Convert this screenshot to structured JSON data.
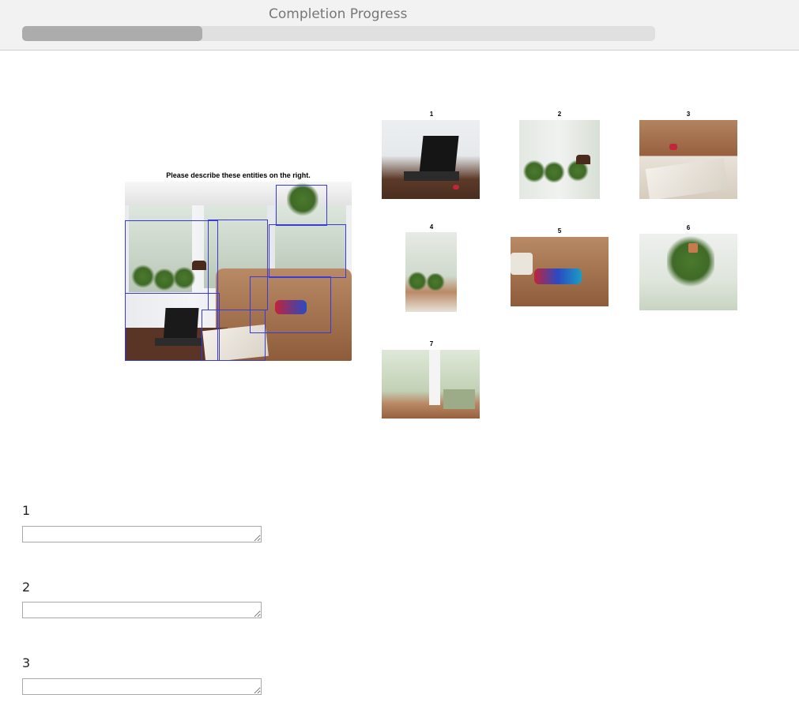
{
  "progress": {
    "label": "Completion Progress",
    "fraction": 0.285
  },
  "main_image": {
    "title": "Please describe these entities on the right."
  },
  "thumbnails": [
    {
      "label": "1"
    },
    {
      "label": "2"
    },
    {
      "label": "3"
    },
    {
      "label": "4"
    },
    {
      "label": "5"
    },
    {
      "label": "6"
    },
    {
      "label": "7"
    }
  ],
  "questions": [
    {
      "label": "1",
      "value": ""
    },
    {
      "label": "2",
      "value": ""
    },
    {
      "label": "3",
      "value": ""
    }
  ]
}
